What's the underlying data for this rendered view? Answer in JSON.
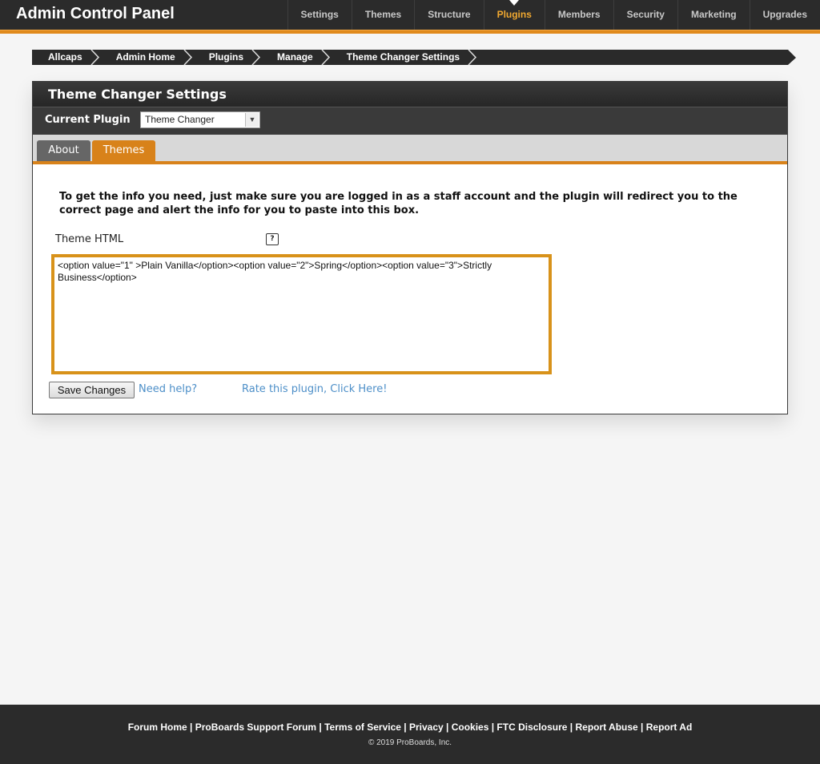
{
  "app": {
    "title": "Admin Control Panel"
  },
  "nav": [
    {
      "label": "Settings",
      "active": false
    },
    {
      "label": "Themes",
      "active": false
    },
    {
      "label": "Structure",
      "active": false
    },
    {
      "label": "Plugins",
      "active": true
    },
    {
      "label": "Members",
      "active": false
    },
    {
      "label": "Security",
      "active": false
    },
    {
      "label": "Marketing",
      "active": false
    },
    {
      "label": "Upgrades",
      "active": false
    }
  ],
  "breadcrumb": [
    "Allcaps",
    "Admin Home",
    "Plugins",
    "Manage",
    "Theme Changer Settings"
  ],
  "panel": {
    "title": "Theme Changer Settings",
    "current_plugin_label": "Current Plugin",
    "current_plugin_value": "Theme Changer",
    "tabs": [
      {
        "label": "About"
      },
      {
        "label": "Themes"
      }
    ],
    "active_tab": "Themes",
    "description": "To get the info you need, just make sure you are logged in as a staff account and the plugin will redirect you to the correct page and alert the info for you to paste into this box.",
    "field_label": "Theme HTML",
    "help_icon_glyph": "?",
    "theme_html_value": "<option value=\"1\" >Plain Vanilla</option><option value=\"2\">Spring</option><option value=\"3\">Strictly Business</option>",
    "save_label": "Save Changes",
    "need_help_label": "Need help?",
    "rate_label": "Rate this plugin, Click Here!"
  },
  "footer": {
    "links": [
      "Forum Home",
      "ProBoards Support Forum",
      "Terms of Service",
      "Privacy",
      "Cookies",
      "FTC Disclosure",
      "Report Abuse",
      "Report Ad"
    ],
    "copyright": "© 2019 ProBoards, Inc."
  },
  "colors": {
    "accent": "#d8821a",
    "nav_active": "#f0a830",
    "link": "#4d8fc8",
    "dark": "#2b2b2b"
  }
}
